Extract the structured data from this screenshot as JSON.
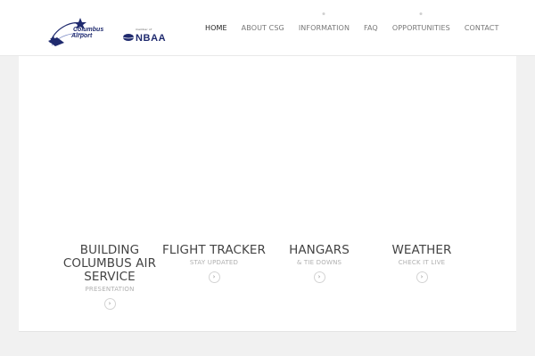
{
  "header": {
    "logo_alt": "Columbus Airport",
    "partner_small": "member of",
    "partner_name": "NBAA"
  },
  "nav": {
    "items": [
      {
        "label": "HOME",
        "active": true
      },
      {
        "label": "ABOUT CSG",
        "active": false
      },
      {
        "label": "INFORMATION",
        "active": false
      },
      {
        "label": "FAQ",
        "active": false
      },
      {
        "label": "OPPORTUNITIES",
        "active": false
      },
      {
        "label": "CONTACT",
        "active": false
      }
    ]
  },
  "features": [
    {
      "title": "BUILDING COLUMBUS AIR SERVICE",
      "subtitle": "PRESENTATION",
      "button_icon": "chevron-right-icon"
    },
    {
      "title": "FLIGHT TRACKER",
      "subtitle": "STAY UPDATED",
      "button_icon": "chevron-right-icon"
    },
    {
      "title": "HANGARS",
      "subtitle": "& TIE DOWNS",
      "button_icon": "chevron-right-icon"
    },
    {
      "title": "WEATHER",
      "subtitle": "CHECK IT LIVE",
      "button_icon": "chevron-right-icon"
    }
  ],
  "colors": {
    "brand_blue": "#1f2a6e",
    "page_bg": "#f1f1f1",
    "content_bg": "#ffffff"
  }
}
